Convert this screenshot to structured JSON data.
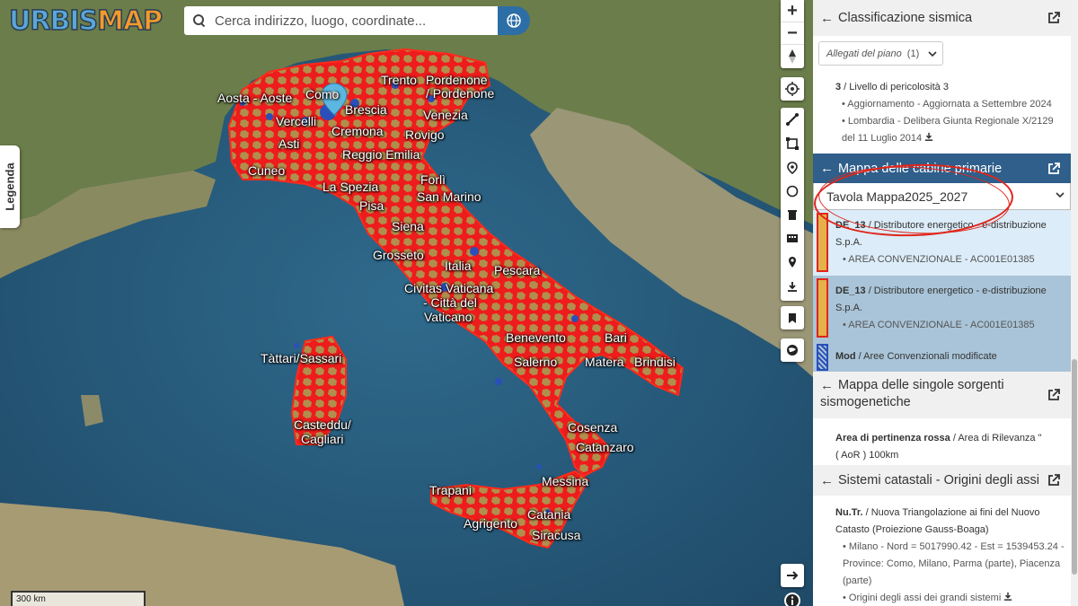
{
  "app": {
    "logo_left": "URBIS",
    "logo_right": "MAP"
  },
  "search": {
    "placeholder": "Cerca indirizzo, luogo, coordinate..."
  },
  "legend_tab": "Legenda",
  "scale": "300 km",
  "map": {
    "cities": [
      "Trento",
      "Pordenone",
      "/ Pordenone",
      "Como",
      "Aosta - Aoste",
      "Brescia",
      "Venezia",
      "Vercelli",
      "Cremona",
      "Rovigo",
      "Asti",
      "Reggio Emilia",
      "Cuneo",
      "Forlì",
      "La Spezia",
      "San Marino",
      "Pisa",
      "Siena",
      "Grosseto",
      "Italia",
      "Pescara",
      "Civitas Vaticana",
      "- Città del",
      "Vaticano",
      "Bari",
      "Benevento",
      "Tàttari/Sassari",
      "Matera",
      "Brindisi",
      "Salerno",
      "Cosenza",
      "Casteddu/",
      "Cagliari",
      "Catanzaro",
      "Messina",
      "Trapani",
      "Catania",
      "Agrigento",
      "Siracusa"
    ]
  },
  "panel": {
    "seismic": {
      "title": "Classificazione sismica",
      "allegati_label": "Allegati del piano",
      "allegati_count": "(1)",
      "level_code": "3",
      "level_text": " / Livello di pericolosità 3",
      "update": "• Aggiornamento - Aggiornata a Settembre 2024",
      "region": "• Lombardia - Delibera Giunta Regionale X/2129",
      "region_date": "del 11 Luglio 2014"
    },
    "cabine": {
      "title": "Mappa delle cabine primarie",
      "selected": "Tavola Mappa2025_2027",
      "rows": [
        {
          "code": "DE_13",
          "text": " / Distributore energetico - e-distribuzione",
          "text2": "S.p.A.",
          "sub": "• AREA CONVENZIONALE - AC001E01385"
        },
        {
          "code": "DE_13",
          "text": " / Distributore energetico - e-distribuzione",
          "text2": "S.p.A.",
          "sub": "• AREA CONVENZIONALE - AC001E01385"
        },
        {
          "code": "Mod",
          "text": " / Aree Convenzionali modificate"
        }
      ]
    },
    "sorgenti": {
      "title1": "Mappa delle singole sorgenti",
      "title2": "sismogenetiche",
      "code": "Area di pertinenza rossa",
      "text": " / Area di Rilevanza \"",
      "text2": "( AoR ) 100km"
    },
    "catastali": {
      "title": "Sistemi catastali - Origini degli assi",
      "code": "Nu.Tr.",
      "text": " / Nuova Triangolazione ai fini del Nuovo",
      "text2": "Catasto (Proiezione Gauss-Boaga)",
      "line1": "• Milano - Nord = 5017990.42 - Est = 1539453.24 -",
      "line2": "Province: Como, Milano, Parma (parte), Piacenza",
      "line3": "(parte)",
      "line4": "• Origini degli assi dei grandi sistemi"
    }
  },
  "colors": {
    "accent": "#2f5f8a",
    "territory": "#ee1c1c",
    "annotation": "#e0261b"
  }
}
